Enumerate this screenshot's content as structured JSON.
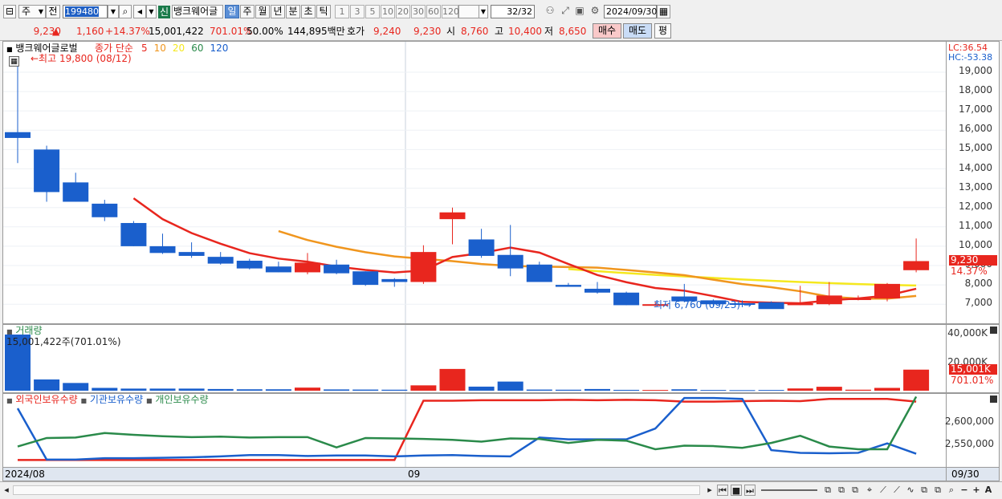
{
  "toolbar": {
    "market_label": "주",
    "prefix_label": "전",
    "code_value": "199480",
    "new_badge": "신",
    "stock_name": "뱅크웨어글",
    "period_tabs": [
      "일",
      "주",
      "월",
      "년",
      "분",
      "초",
      "틱"
    ],
    "period_selected": "일",
    "count_buttons": [
      "1",
      "3",
      "5",
      "10",
      "20",
      "30",
      "60",
      "120"
    ],
    "page_display": "32",
    "page_total": "/32",
    "date_value": "2024/09/30"
  },
  "quote": {
    "price": "9,230",
    "up_arrow": "▲",
    "change": "1,160",
    "change_pct": "+14.37%",
    "volume": "15,001,422",
    "volume_ratio": "701.01%",
    "ratio2": "50.00%",
    "amount": "144,895백만",
    "bid_label": "호가",
    "bid1": "9,240",
    "bid2": "9,230",
    "open_label": "시",
    "open": "8,760",
    "high_label": "고",
    "high": "10,400",
    "low_label": "저",
    "low": "8,650",
    "buy_label": "매수",
    "sell_label": "매도",
    "eval_label": "평"
  },
  "price_panel": {
    "title": "뱅크웨어글로벌",
    "ma_label": "종가 단순",
    "ma_periods": [
      "5",
      "10",
      "20",
      "60",
      "120"
    ],
    "high_annot": "←최고 19,800 (08/12)",
    "low_annot": "최저 6,760 (09/23) →",
    "lc": "LC:36.54",
    "hc": "HC:-53.38",
    "current_price_tag": "9,230",
    "current_pct_tag": "14.37%",
    "y_ticks": [
      "19,000",
      "18,000",
      "17,000",
      "16,000",
      "15,000",
      "14,000",
      "13,000",
      "12,000",
      "11,000",
      "10,000",
      "9,000",
      "8,000",
      "7,000"
    ]
  },
  "volume_panel": {
    "title": "거래량",
    "info": "15,001,422주(701.01%)",
    "y_ticks": [
      "40,000K",
      "20,000K"
    ],
    "current_tag": "15,001K",
    "current_pct": "701.01%"
  },
  "holdings_panel": {
    "legend": [
      "외국인보유수량",
      "기관보유수량",
      "개인보유수량"
    ],
    "y_ticks": [
      "2,600,000",
      "2,550,000"
    ]
  },
  "x_axis": {
    "labels": [
      "2024/08",
      "09"
    ],
    "right_label": "09/30"
  },
  "colors": {
    "up": "#e8261e",
    "down": "#1a5fcc",
    "ma5": "#e8261e",
    "ma10": "#f0961e",
    "ma20": "#f5e81e",
    "ma60": "#2a8a4a",
    "ma120": "#1a5fcc"
  },
  "chart_data": {
    "type": "candlestick",
    "candles": [
      {
        "o": 15900,
        "h": 19800,
        "l": 14300,
        "c": 15600
      },
      {
        "o": 15000,
        "h": 15200,
        "l": 12300,
        "c": 12800
      },
      {
        "o": 13300,
        "h": 13800,
        "l": 12300,
        "c": 12300
      },
      {
        "o": 12200,
        "h": 12400,
        "l": 11300,
        "c": 11500
      },
      {
        "o": 11200,
        "h": 11300,
        "l": 10000,
        "c": 10000
      },
      {
        "o": 10000,
        "h": 10650,
        "l": 9600,
        "c": 9650
      },
      {
        "o": 9700,
        "h": 10200,
        "l": 9400,
        "c": 9500
      },
      {
        "o": 9450,
        "h": 9700,
        "l": 9050,
        "c": 9100
      },
      {
        "o": 9250,
        "h": 9350,
        "l": 8800,
        "c": 8850
      },
      {
        "o": 8950,
        "h": 9200,
        "l": 8650,
        "c": 8650
      },
      {
        "o": 8650,
        "h": 9650,
        "l": 8550,
        "c": 9150
      },
      {
        "o": 9050,
        "h": 9300,
        "l": 8550,
        "c": 8600
      },
      {
        "o": 8700,
        "h": 8700,
        "l": 7950,
        "c": 8000
      },
      {
        "o": 8300,
        "h": 8350,
        "l": 7900,
        "c": 8150
      },
      {
        "o": 8150,
        "h": 10050,
        "l": 8050,
        "c": 9700
      },
      {
        "o": 11400,
        "h": 12000,
        "l": 10100,
        "c": 11750
      },
      {
        "o": 10350,
        "h": 10900,
        "l": 9400,
        "c": 9500
      },
      {
        "o": 9550,
        "h": 11100,
        "l": 8450,
        "c": 8850
      },
      {
        "o": 9050,
        "h": 9200,
        "l": 8150,
        "c": 8150
      },
      {
        "o": 8000,
        "h": 8100,
        "l": 7900,
        "c": 7900
      },
      {
        "o": 7800,
        "h": 8150,
        "l": 7550,
        "c": 7600
      },
      {
        "o": 7600,
        "h": 7650,
        "l": 6950,
        "c": 6950
      },
      {
        "o": 7000,
        "h": 7150,
        "l": 6900,
        "c": 7000
      },
      {
        "o": 7400,
        "h": 8050,
        "l": 7100,
        "c": 7150
      },
      {
        "o": 7200,
        "h": 7250,
        "l": 6900,
        "c": 7000
      },
      {
        "o": 7050,
        "h": 7200,
        "l": 6850,
        "c": 7000
      },
      {
        "o": 7100,
        "h": 7150,
        "l": 6760,
        "c": 6750
      },
      {
        "o": 6950,
        "h": 7950,
        "l": 6950,
        "c": 7050
      },
      {
        "o": 7000,
        "h": 8150,
        "l": 6950,
        "c": 7450
      },
      {
        "o": 7250,
        "h": 7450,
        "l": 7200,
        "c": 7300
      },
      {
        "o": 7300,
        "h": 8100,
        "l": 7150,
        "c": 8050
      },
      {
        "o": 8760,
        "h": 10400,
        "l": 8650,
        "c": 9230
      }
    ],
    "ma5": [
      null,
      null,
      null,
      null,
      12480,
      11400,
      10680,
      10130,
      9640,
      9360,
      9200,
      8950,
      8770,
      8640,
      8750,
      9440,
      9650,
      9930,
      9670,
      9080,
      8510,
      8140,
      7840,
      7700,
      7420,
      7120,
      7080,
      7050,
      7200,
      7300,
      7450,
      7800
    ],
    "ma10": [
      null,
      null,
      null,
      null,
      null,
      null,
      null,
      null,
      null,
      10780,
      10320,
      9970,
      9690,
      9470,
      9350,
      9230,
      9080,
      8980,
      8950,
      8920,
      8890,
      8770,
      8640,
      8500,
      8270,
      8040,
      7880,
      7670,
      7390,
      7290,
      7290,
      7430
    ],
    "ma20": [
      null,
      null,
      null,
      null,
      null,
      null,
      null,
      null,
      null,
      null,
      null,
      null,
      null,
      null,
      null,
      null,
      null,
      null,
      null,
      8820,
      8710,
      8610,
      8520,
      8440,
      8360,
      8280,
      8210,
      8150,
      8090,
      8040,
      8000,
      7970
    ],
    "volume_k": [
      40000,
      8000,
      5500,
      2000,
      1500,
      1500,
      1500,
      1200,
      1000,
      1000,
      2200,
      900,
      800,
      700,
      3800,
      15500,
      2900,
      6500,
      800,
      700,
      1200,
      600,
      500,
      1000,
      500,
      400,
      500,
      1600,
      2800,
      700,
      2000,
      15001
    ],
    "foreign": [
      2510000,
      2510000,
      2510000,
      2510000,
      2510000,
      2510000,
      2510000,
      2510000,
      2510000,
      2510000,
      2510000,
      2510000,
      2510000,
      2510000,
      2642000,
      2642000,
      2643000,
      2643000,
      2643000,
      2644000,
      2643000,
      2644000,
      2643000,
      2640000,
      2640000,
      2641000,
      2642000,
      2641000,
      2646000,
      2646000,
      2646000,
      2640000
    ],
    "institution": [
      2625000,
      2511000,
      2511000,
      2514000,
      2514000,
      2515000,
      2516000,
      2518000,
      2521000,
      2521000,
      2519000,
      2520000,
      2520000,
      2518000,
      2520000,
      2521000,
      2519000,
      2518000,
      2560000,
      2556000,
      2556000,
      2556000,
      2580000,
      2648000,
      2648000,
      2646000,
      2532000,
      2526000,
      2525000,
      2526000,
      2547000,
      2524000
    ],
    "individual": [
      2540000,
      2559000,
      2560000,
      2570000,
      2566000,
      2563000,
      2561000,
      2562000,
      2560000,
      2561000,
      2561000,
      2538000,
      2559000,
      2558000,
      2557000,
      2555000,
      2551000,
      2558000,
      2557000,
      2548000,
      2555000,
      2553000,
      2534000,
      2542000,
      2541000,
      2537000,
      2548000,
      2564000,
      2540000,
      2534000,
      2534000,
      2651000
    ]
  }
}
